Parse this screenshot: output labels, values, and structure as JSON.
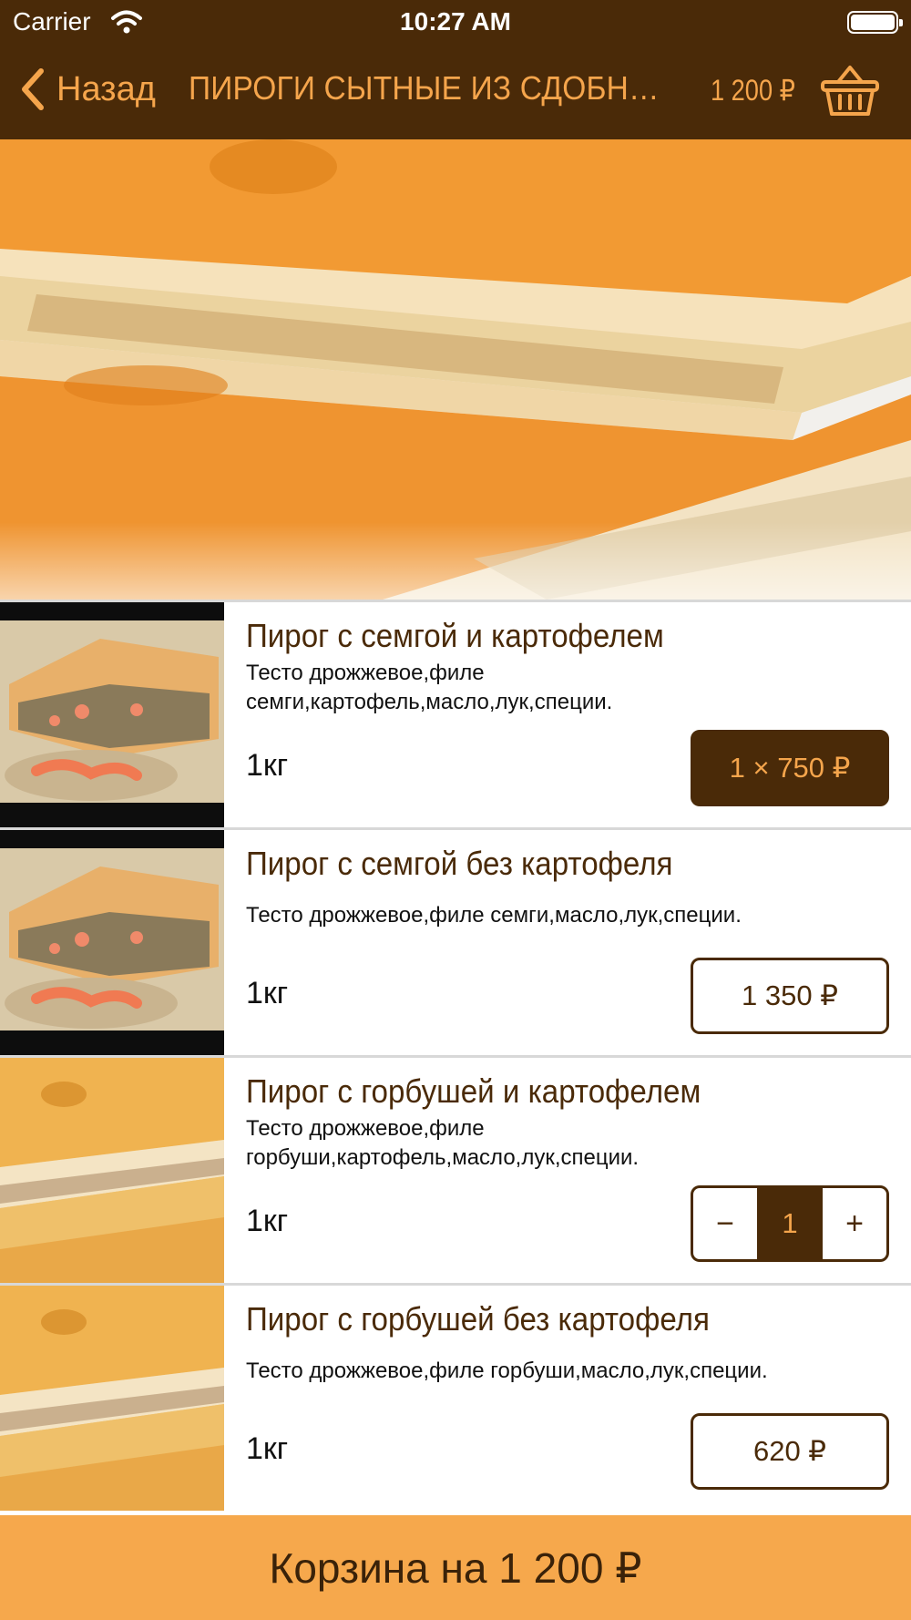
{
  "status_bar": {
    "carrier": "Carrier",
    "time": "10:27 AM"
  },
  "nav": {
    "back_label": "Назад",
    "title": "ПИРОГИ СЫТНЫЕ ИЗ СДОБНОГО…",
    "total": "1 200 ₽",
    "icons": {
      "back": "chevron-left-icon",
      "cart": "basket-icon"
    }
  },
  "colors": {
    "header_bg": "#4a2a08",
    "accent": "#f5a54c",
    "cart_bar": "#f6a84c"
  },
  "products": [
    {
      "title": "Пирог с семгой и картофелем",
      "description": "Тесто дрожжевое,филе семги,картофель,масло,лук,специи.",
      "weight": "1кг",
      "control": "price-in-cart",
      "price_label": "1 × 750 ₽"
    },
    {
      "title": "Пирог с семгой без картофеля",
      "description": "Тесто дрожжевое,филе семги,масло,лук,специи.",
      "weight": "1кг",
      "control": "price",
      "price_label": "1 350 ₽"
    },
    {
      "title": "Пирог с горбушей и картофелем",
      "description": "Тесто дрожжевое,филе горбуши,картофель,масло,лук,специи.",
      "weight": "1кг",
      "control": "stepper",
      "stepper": {
        "minus": "−",
        "value": "1",
        "plus": "+"
      }
    },
    {
      "title": "Пирог с горбушей без картофеля",
      "description": "Тесто дрожжевое,филе горбуши,масло,лук,специи.",
      "weight": "1кг",
      "control": "price",
      "price_label": "620 ₽"
    }
  ],
  "cart_bar": {
    "label": "Корзина на 1 200 ₽"
  }
}
